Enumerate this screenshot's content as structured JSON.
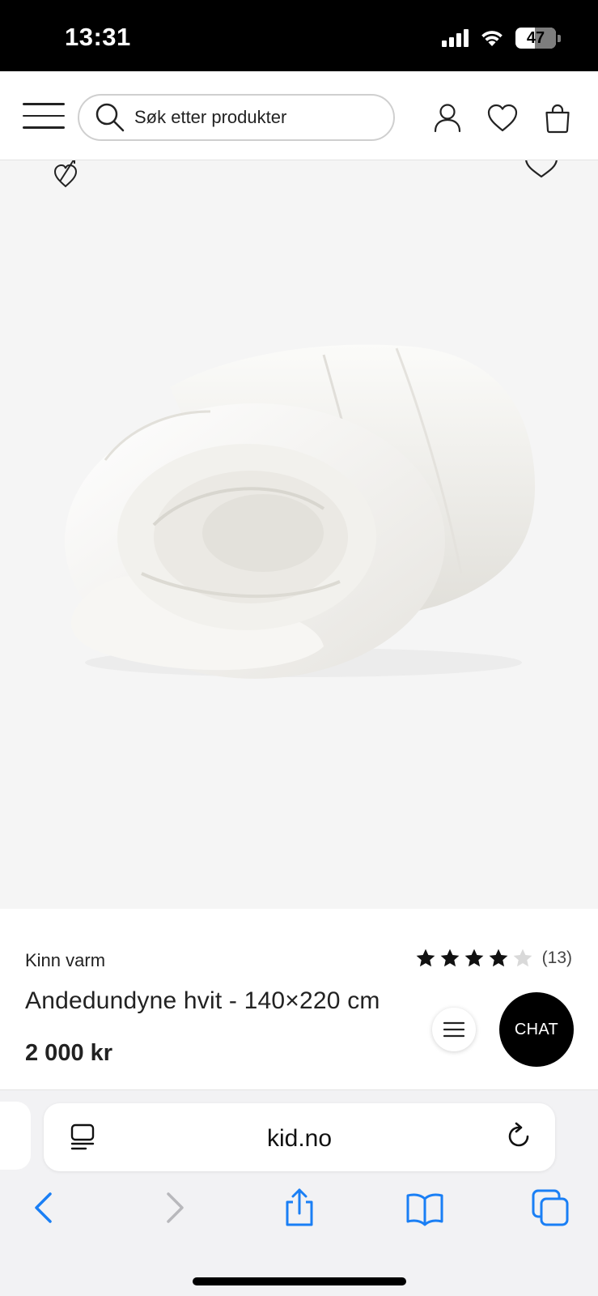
{
  "status_bar": {
    "time": "13:31",
    "battery": "47",
    "battery_level": 0.47
  },
  "header": {
    "search_placeholder": "Søk etter produkter",
    "icons": [
      "menu-icon",
      "search-icon",
      "account-icon",
      "heart-icon",
      "bag-icon"
    ]
  },
  "product": {
    "brand": "Kinn varm",
    "title": "Andedundyne hvit - 140×220 cm",
    "price": "2 000 kr",
    "rating_value": 4,
    "rating_max": 5,
    "rating_count": "(13)"
  },
  "chat": {
    "label": "CHAT"
  },
  "browser": {
    "url": "kid.no"
  },
  "colors": {
    "media_bg": "#f5f5f5",
    "chat_bg": "#000000",
    "ios_blue": "#1a7ff5",
    "star": "#111111",
    "star_empty": "#d9d9d9"
  }
}
